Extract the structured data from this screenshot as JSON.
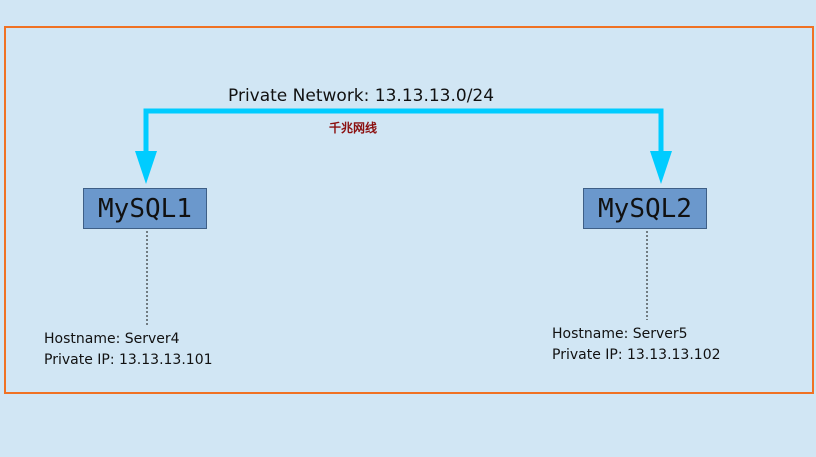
{
  "network": {
    "label": "Private Network: 13.13.13.0/24",
    "sublabel": "千兆网线"
  },
  "nodes": [
    {
      "name": "MySQL1",
      "hostname": "Hostname: Server4",
      "private_ip": "Private IP: 13.13.13.101"
    },
    {
      "name": "MySQL2",
      "hostname": "Hostname: Server5",
      "private_ip": "Private IP: 13.13.13.102"
    }
  ],
  "colors": {
    "background": "#d1e6f4",
    "frame_border": "#f07224",
    "network_line": "#00ccff",
    "node_fill": "#6b98cc",
    "sublabel": "#8b1010"
  }
}
